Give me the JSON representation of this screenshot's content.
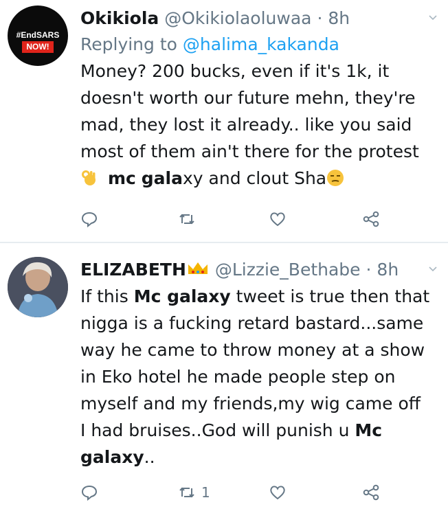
{
  "tweets": [
    {
      "name": "Okikiola",
      "handle": "@Okikiolaoluwaa",
      "time": "8h",
      "replying_prefix": "Replying to",
      "replying_to": "@halima_kakanda",
      "avatar": {
        "tag_line1": "#EndSARS",
        "tag_line2": "NOW!"
      },
      "body": {
        "l1": "Money? 200 bucks, even if it's 1k, it",
        "l2": "doesn't worth our future mehn, they're",
        "l3": "mad, they lost it already.. like you said",
        "l4": "most of them ain't there for the protest",
        "l5_mc": "mc",
        "l5_gala": "gala",
        "l5_rest": "xy and clout Sha"
      },
      "emojis": [
        "ok-hand-emoji",
        "unamused-face-emoji"
      ],
      "actions": {
        "reply_count": "",
        "retweet_count": "",
        "like_count": ""
      }
    },
    {
      "name": "ELIZABETH",
      "name_decoration": "crown-emoji",
      "handle": "@Lizzie_Bethabe",
      "time": "8h",
      "body": {
        "l1_pre": "If this ",
        "l1_bold": "Mc galaxy",
        "l1_post": " tweet is true then that",
        "l2": "nigga is a fucking retard bastard...same",
        "l3": "way he came to throw money at a show",
        "l4": "in Eko hotel he made people step on",
        "l5": "myself and my friends,my wig came off",
        "l6_pre": "I had bruises..God will punish u ",
        "l6_bold": "Mc",
        "l7_bold": "galaxy",
        "l7_post": ".."
      },
      "actions": {
        "reply_count": "",
        "retweet_count": "1",
        "like_count": ""
      }
    }
  ],
  "separator_dot": "·",
  "colors": {
    "accent": "#1da1f2",
    "muted": "#657786",
    "text": "#14171a",
    "badge": "#e0241b"
  }
}
